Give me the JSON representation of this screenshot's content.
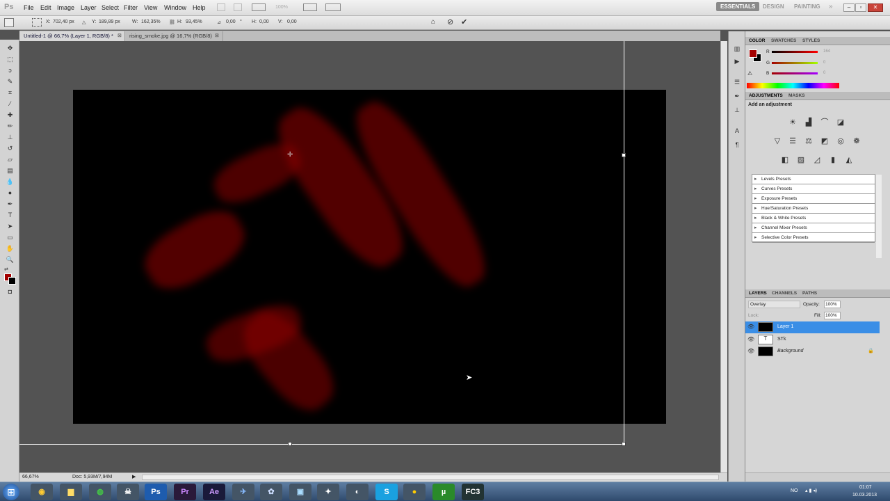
{
  "menubar": {
    "app_logo": "Ps",
    "items": [
      "File",
      "Edit",
      "Image",
      "Layer",
      "Select",
      "Filter",
      "View",
      "Window",
      "Help"
    ],
    "zoom_display": "100%",
    "workspaces": [
      "ESSENTIALS",
      "DESIGN",
      "PAINTING"
    ],
    "active_workspace": "ESSENTIALS"
  },
  "options_bar": {
    "x_label": "X:",
    "x_value": "702,40 px",
    "y_label": "Y:",
    "y_value": "189,89 px",
    "w_label": "W:",
    "w_value": "162,35%",
    "h_label": "H:",
    "h_value": "93,45%",
    "angle_value": "0,00",
    "h_skew_label": "H:",
    "h_skew_value": "0,00",
    "v_skew_label": "V:",
    "v_skew_value": "0,00"
  },
  "tabs": [
    {
      "label": "Untitled-1 @ 66,7% (Layer 1, RGB/8) *",
      "active": true
    },
    {
      "label": "rising_smoke.jpg @ 16,7% (RGB/8)",
      "active": false
    }
  ],
  "status": {
    "zoom": "66,67%",
    "doc": "Doc: 5,93M/7,94M"
  },
  "color_panel": {
    "tabs": [
      "COLOR",
      "SWATCHES",
      "STYLES"
    ],
    "r_label": "R",
    "r_value": "164",
    "g_label": "G",
    "g_value": "0",
    "b_label": "B",
    "b_value": "0",
    "fg_color": "#a40000"
  },
  "adjustments_panel": {
    "tabs": [
      "ADJUSTMENTS",
      "MASKS"
    ],
    "heading": "Add an adjustment",
    "presets": [
      "Levels Presets",
      "Curves Presets",
      "Exposure Presets",
      "Hue/Saturation Presets",
      "Black & White Presets",
      "Channel Mixer Presets",
      "Selective Color Presets"
    ]
  },
  "layers_panel": {
    "tabs": [
      "LAYERS",
      "CHANNELS",
      "PATHS"
    ],
    "blend_mode": "Overlay",
    "opacity_label": "Opacity:",
    "opacity_value": "100%",
    "lock_label": "Lock:",
    "fill_label": "Fill:",
    "fill_value": "100%",
    "layers": [
      {
        "name": "Layer 1",
        "selected": true
      },
      {
        "name": "STk",
        "selected": false
      },
      {
        "name": "Background",
        "selected": false
      }
    ],
    "text_layer_thumb": "T"
  },
  "taskbar": {
    "apps": [
      "Pr",
      "Ae",
      "FC3"
    ],
    "ps_label": "Ps",
    "lang": "NO",
    "time": "01:07",
    "date": "10.03.2013"
  }
}
